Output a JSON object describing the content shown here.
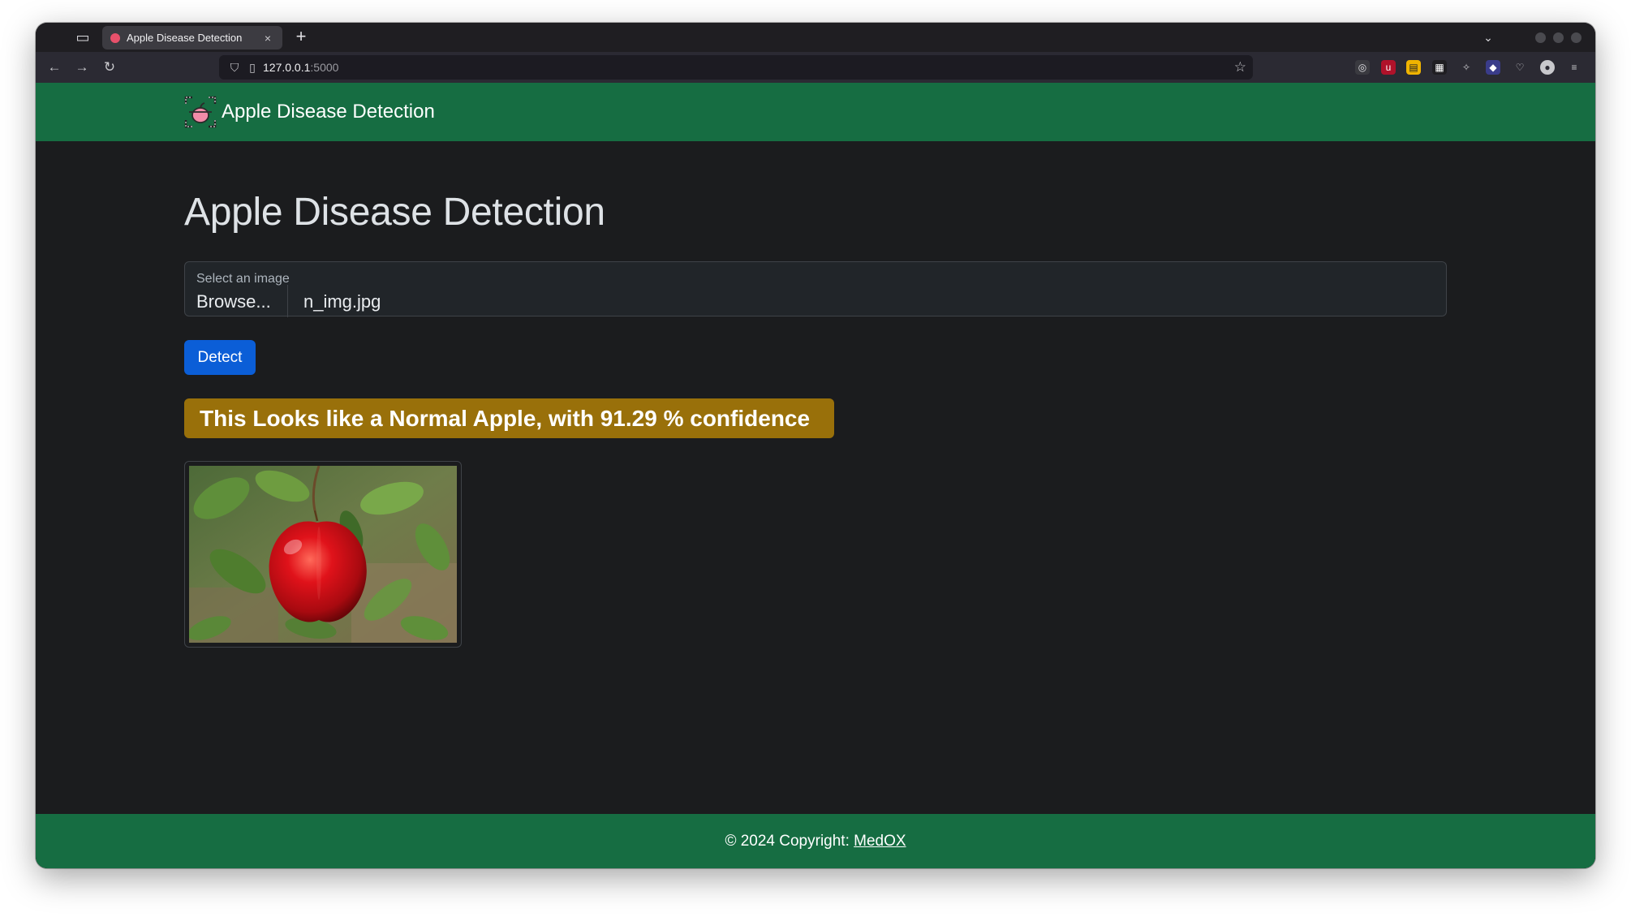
{
  "browser": {
    "tab_title": "Apple Disease Detection",
    "tab_close": "×",
    "new_tab": "+",
    "url_host": "127.0.0.1",
    "url_port": ":5000"
  },
  "navbar": {
    "brand": "Apple Disease Detection"
  },
  "main": {
    "title": "Apple Disease Detection",
    "file_input": {
      "label": "Select an image",
      "browse": "Browse...",
      "filename": "n_img.jpg"
    },
    "detect_button": "Detect",
    "result": {
      "prefix": "This Looks like a ",
      "label": "Normal Apple",
      "suffix": ", with 91.29 % confidence"
    }
  },
  "footer": {
    "text": "© 2024 Copyright: ",
    "link": "MedOX"
  },
  "colors": {
    "navbar": "#166d42",
    "background": "#1b1c1e",
    "primary_button": "#0b5ed7",
    "result_alert": "#99700a"
  }
}
